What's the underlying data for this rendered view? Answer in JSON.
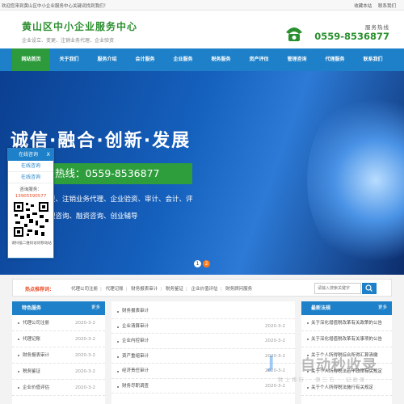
{
  "topbar": {
    "welcome": "欢迎您来到黄山区中小企业服务中心关键词找到我们！",
    "links": [
      "收藏本站",
      "联系我们"
    ]
  },
  "header": {
    "title": "黄山区中小企业服务中心",
    "subtitle": "企业设立、变更、注销业务代理、企业验资",
    "hotline_label": "服务热线",
    "hotline_number": "0559-8536877"
  },
  "nav": {
    "items": [
      "网站首页",
      "关于我们",
      "服务介绍",
      "会计服务",
      "企业服务",
      "税务服务",
      "资产评估",
      "管理咨询",
      "代理服务",
      "联系我们"
    ],
    "active_index": 0
  },
  "banner": {
    "headline": "诚信·融合·创新·发展",
    "hotline": "热线：0559-8536877",
    "services_line1": "更、注销业务代理、企业验资、审计、会计、评",
    "services_line2": "理咨询、融资咨询、创业辅导",
    "slides": [
      "1",
      "2"
    ],
    "active_slide": 1
  },
  "hot_keywords": {
    "label": "热点推荐词：",
    "items": [
      "代理公司注册",
      "代理记账",
      "财务报表审计",
      "税务鉴证",
      "企业价值评估",
      "财务顾问服务"
    ],
    "search_placeholder": "请输入搜索关键字"
  },
  "features": {
    "title": "特色服务",
    "more": "更多",
    "items": [
      {
        "title": "代理公司注册",
        "date": "2020-3-2"
      },
      {
        "title": "代理记账",
        "date": "2020-3-2"
      },
      {
        "title": "财务报表审计",
        "date": "2020-3-2"
      },
      {
        "title": "税务鉴证",
        "date": "2020-3-2"
      },
      {
        "title": "企业价值评估",
        "date": "2020-3-2"
      }
    ]
  },
  "services": {
    "items": [
      {
        "title": "财务报表审计",
        "date": ""
      },
      {
        "title": "企业清算审计",
        "date": "2020-3-2"
      },
      {
        "title": "企业内控审计",
        "date": "2020-3-2"
      },
      {
        "title": "资产重组审计",
        "date": "2020-3-2"
      },
      {
        "title": "经济责任审计",
        "date": "2020-3-2"
      },
      {
        "title": "财务尽职调查",
        "date": "2020-3-2"
      }
    ]
  },
  "news": {
    "title": "最新法规",
    "more": "更多",
    "items": [
      {
        "title": "关于深化增值税改革有关政策的公告"
      },
      {
        "title": "关于深化增值税改革有关事项的公告"
      },
      {
        "title": "关于个人所得税综合所得汇算清缴"
      },
      {
        "title": "关于个人所得税法若干政策有关规定"
      },
      {
        "title": "关于个人所得税法施行有关规定"
      }
    ]
  },
  "chat": {
    "title": "在线咨询",
    "close": "X",
    "items": [
      "在线咨询",
      "在线咨询"
    ],
    "hotline_label": "咨询服务：",
    "hotline_number": "13905590577",
    "qr_caption": "请扫描二维码访问移动站"
  },
  "watermark": {
    "brand": "自动秒收录",
    "sub": "数上排行 · 第三方 · 记收录"
  }
}
